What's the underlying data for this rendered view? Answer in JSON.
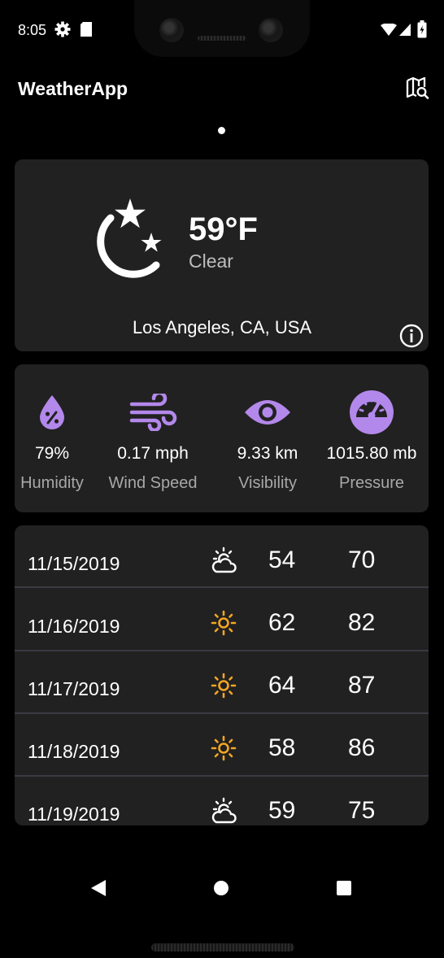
{
  "status_bar": {
    "time": "8:05",
    "icons": [
      "gear-icon",
      "sd-card-icon",
      "wifi-icon",
      "signal-icon",
      "battery-icon"
    ]
  },
  "app_bar": {
    "title": "WeatherApp",
    "action_icon": "map-search-icon"
  },
  "current": {
    "temperature": "59°F",
    "condition": "Clear",
    "location": "Los Angeles, CA, USA",
    "icon": "moon-stars-icon"
  },
  "stats": [
    {
      "icon": "humidity-icon",
      "value": "79%",
      "label": "Humidity"
    },
    {
      "icon": "wind-icon",
      "value": "0.17 mph",
      "label": "Wind Speed"
    },
    {
      "icon": "eye-icon",
      "value": "9.33 km",
      "label": "Visibility"
    },
    {
      "icon": "gauge-icon",
      "value": "1015.80 mb",
      "label": "Pressure"
    }
  ],
  "forecast": [
    {
      "date": "11/15/2019",
      "icon": "partly-cloudy-icon",
      "low": "54",
      "high": "70"
    },
    {
      "date": "11/16/2019",
      "icon": "sunny-icon",
      "low": "62",
      "high": "82"
    },
    {
      "date": "11/17/2019",
      "icon": "sunny-icon",
      "low": "64",
      "high": "87"
    },
    {
      "date": "11/18/2019",
      "icon": "sunny-icon",
      "low": "58",
      "high": "86"
    },
    {
      "date": "11/19/2019",
      "icon": "partly-cloudy-icon",
      "low": "59",
      "high": "75"
    }
  ],
  "colors": {
    "accent": "#b388eb",
    "sun": "#f5a623",
    "card": "#212121",
    "background": "#000000"
  }
}
